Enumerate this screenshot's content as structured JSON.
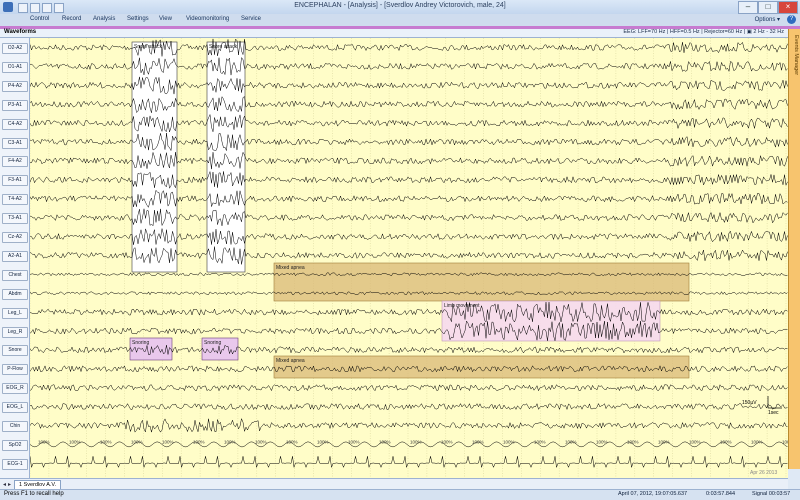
{
  "window": {
    "title": "ENCEPHALAN - [Analysis] - [Sverdlov Andrey Victorovich, male, 24]",
    "min_icon": "minimize-icon",
    "max_icon": "maximize-icon",
    "close_icon": "close-icon"
  },
  "menu": {
    "items": [
      "Control",
      "Record",
      "Analysis",
      "Settings",
      "View",
      "Videomonitoring",
      "Service"
    ],
    "options": "Options ▾",
    "help": "?"
  },
  "pane": {
    "title": "Waveforms",
    "filter_info": "EEG: LFF=70 Hz | HFF=0.5 Hz | Rejector=60 Hz | ▣ 2 Hz - 32 Hz",
    "side_tab": "Events Manager"
  },
  "channels": [
    "O2-A2",
    "O1-A1",
    "P4-A2",
    "P3-A1",
    "C4-A2",
    "C3-A1",
    "F4-A2",
    "F3-A1",
    "T4-A2",
    "T3-A1",
    "Cz-A2",
    "A2-A1",
    "Chest",
    "Abdm",
    "Leg_L",
    "Leg_R",
    "Snore",
    "P-Flow",
    "EOG_R",
    "EOG_L",
    "Chin",
    "SpO2",
    "ECG-1"
  ],
  "events": [
    {
      "label": "Snore attack",
      "kind": "snore"
    },
    {
      "label": "Snore attack",
      "kind": "snore"
    },
    {
      "label": "Mixed apnea",
      "kind": "apnea"
    },
    {
      "label": "Mixed apnea",
      "kind": "apnea"
    },
    {
      "label": "Limb movement",
      "kind": "limb"
    },
    {
      "label": "Snoring",
      "kind": "snore-small"
    },
    {
      "label": "Snoring",
      "kind": "snore-small"
    }
  ],
  "spo2_label": "100%",
  "scale_label": "150µV",
  "time_label": "1sec",
  "watermark": "Apr 26 2013",
  "tabs": {
    "patient": "1 Sverdlov A.V."
  },
  "status": {
    "help": "Press F1 to recall help",
    "date": "April 07, 2012, 19:07:05.637",
    "elapsed": "0:03:57.844",
    "signal": "Signal 00:03:57"
  },
  "colors": {
    "background": "#fffdc8",
    "grid": "#c9c58a",
    "trace": "#000000",
    "apnea_fill": "#d9b877",
    "snore_fill": "#ffffff",
    "limb_fill": "#f6d9ee"
  }
}
